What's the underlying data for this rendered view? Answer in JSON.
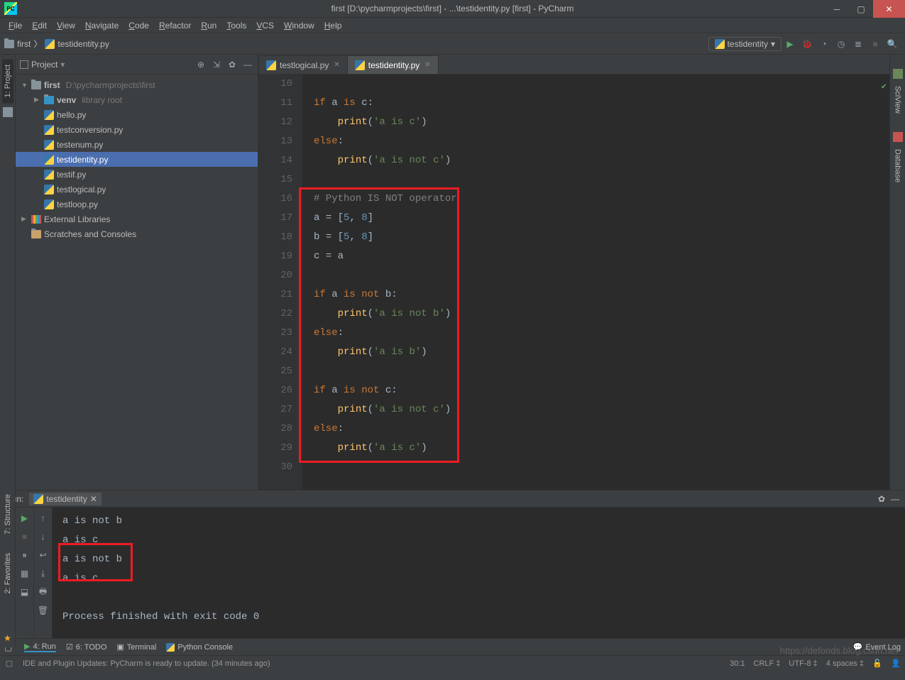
{
  "title": "first [D:\\pycharmprojects\\first] - ...\\testidentity.py [first] - PyCharm",
  "menus": [
    "File",
    "Edit",
    "View",
    "Navigate",
    "Code",
    "Refactor",
    "Run",
    "Tools",
    "VCS",
    "Window",
    "Help"
  ],
  "breadcrumb": {
    "root": "first",
    "file": "testidentity.py"
  },
  "run_config": "testidentity",
  "project": {
    "panel_title": "Project",
    "root": {
      "name": "first",
      "path": "D:\\pycharmprojects\\first"
    },
    "venv": "venv",
    "venv_hint": "library root",
    "files": [
      "hello.py",
      "testconversion.py",
      "testenum.py",
      "testidentity.py",
      "testif.py",
      "testlogical.py",
      "testloop.py"
    ],
    "selected": "testidentity.py",
    "ext_lib": "External Libraries",
    "scratches": "Scratches and Consoles"
  },
  "tabs": [
    {
      "name": "testlogical.py",
      "active": false
    },
    {
      "name": "testidentity.py",
      "active": true
    }
  ],
  "code_lines": [
    {
      "n": 10,
      "html": ""
    },
    {
      "n": 11,
      "html": "<span class='kw'>if</span> <span class='ident'>a</span> <span class='kw'>is</span> <span class='ident'>c</span><span class='punc'>:</span>"
    },
    {
      "n": 12,
      "html": "    <span class='func'>print</span><span class='punc'>(</span><span class='str'>'a is c'</span><span class='punc'>)</span>"
    },
    {
      "n": 13,
      "html": "<span class='kw'>else</span><span class='punc'>:</span>"
    },
    {
      "n": 14,
      "html": "    <span class='func'>print</span><span class='punc'>(</span><span class='str'>'a is not c'</span><span class='punc'>)</span>"
    },
    {
      "n": 15,
      "html": ""
    },
    {
      "n": 16,
      "html": "<span class='cmt'># Python IS NOT operator</span>"
    },
    {
      "n": 17,
      "html": "<span class='ident'>a</span> <span class='punc'>=</span> <span class='punc'>[</span><span class='num'>5</span><span class='punc'>,</span> <span class='num'>8</span><span class='punc'>]</span>"
    },
    {
      "n": 18,
      "html": "<span class='ident'>b</span> <span class='punc'>=</span> <span class='punc'>[</span><span class='num'>5</span><span class='punc'>,</span> <span class='num'>8</span><span class='punc'>]</span>"
    },
    {
      "n": 19,
      "html": "<span class='ident'>c</span> <span class='punc'>=</span> <span class='ident'>a</span>"
    },
    {
      "n": 20,
      "html": ""
    },
    {
      "n": 21,
      "html": "<span class='kw'>if</span> <span class='ident'>a</span> <span class='kw'>is not</span> <span class='ident'>b</span><span class='punc'>:</span>"
    },
    {
      "n": 22,
      "html": "    <span class='func'>print</span><span class='punc'>(</span><span class='str'>'a is not b'</span><span class='punc'>)</span>"
    },
    {
      "n": 23,
      "html": "<span class='kw'>else</span><span class='punc'>:</span>"
    },
    {
      "n": 24,
      "html": "    <span class='func'>print</span><span class='punc'>(</span><span class='str'>'a is b'</span><span class='punc'>)</span>"
    },
    {
      "n": 25,
      "html": ""
    },
    {
      "n": 26,
      "html": "<span class='kw'>if</span> <span class='ident'>a</span> <span class='kw'>is not</span> <span class='ident'>c</span><span class='punc'>:</span>"
    },
    {
      "n": 27,
      "html": "    <span class='func'>print</span><span class='punc'>(</span><span class='str'>'a is not c'</span><span class='punc'>)</span>"
    },
    {
      "n": 28,
      "html": "<span class='kw'>else</span><span class='punc'>:</span>"
    },
    {
      "n": 29,
      "html": "    <span class='func'>print</span><span class='punc'>(</span><span class='str'>'a is c'</span><span class='punc'>)</span>"
    },
    {
      "n": 30,
      "html": ""
    }
  ],
  "run": {
    "label": "Run:",
    "tab": "testidentity",
    "output": [
      "a is not b",
      "a is c",
      "a is not b",
      "a is c",
      "",
      "Process finished with exit code 0"
    ]
  },
  "bottom_tools": {
    "run": "4: Run",
    "todo": "6: TODO",
    "terminal": "Terminal",
    "pyconsole": "Python Console",
    "event_log": "Event Log"
  },
  "right_tools": {
    "sciview": "SciView",
    "database": "Database"
  },
  "left_tools": {
    "project": "1: Project",
    "structure": "7: Structure",
    "favorites": "2: Favorites"
  },
  "status": {
    "msg": "IDE and Plugin Updates: PyCharm is ready to update. (34 minutes ago)",
    "pos": "30:1",
    "sep": "CRLF",
    "enc": "UTF-8",
    "indent": "4 spaces"
  },
  "watermark": "https://defonds.blog.csdn.net"
}
